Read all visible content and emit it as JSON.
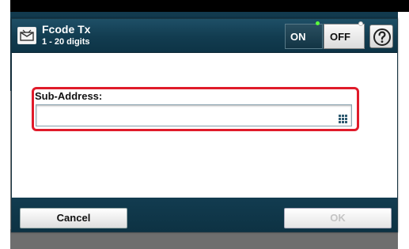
{
  "header": {
    "title": "Fcode Tx",
    "subtitle": "1 - 20 digits",
    "icon": "fcode-fax-icon",
    "toggle_on_label": "ON",
    "toggle_off_label": "OFF",
    "toggle_selected": "OFF",
    "help_icon": "help-icon"
  },
  "field": {
    "label": "Sub-Address:",
    "value": "",
    "placeholder": "",
    "keypad_icon": "keypad-icon",
    "highlight_color": "#e01b2a"
  },
  "footer": {
    "cancel_label": "Cancel",
    "ok_label": "OK",
    "ok_enabled": false
  },
  "colors": {
    "header_bg": "#123c50",
    "led_on": "#5cff3a"
  }
}
